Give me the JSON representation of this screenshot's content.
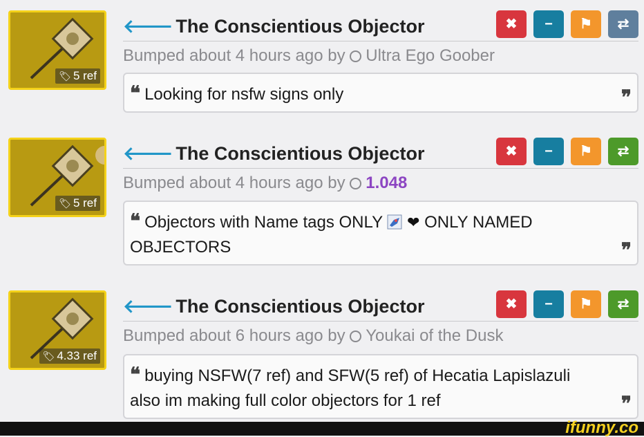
{
  "listings": [
    {
      "title": "The Conscientious Objector",
      "bump_prefix": "Bumped about 4 hours ago by",
      "user": "Ultra Ego Goober",
      "ref": "5 ref",
      "message": "Looking for nsfw signs only"
    },
    {
      "title": "The Conscientious Objector",
      "bump_prefix": "Bumped about 4 hours ago by",
      "user": "1.048",
      "ref": "5 ref",
      "message_part1": "Objectors with Name tags ONLY",
      "message_part2": "ONLY NAMED OBJECTORS"
    },
    {
      "title": "The Conscientious Objector",
      "bump_prefix": "Bumped about 6 hours ago by",
      "user": "Youkai of the Dusk",
      "ref": "4.33 ref",
      "message_line1": "buying NSFW(7 ref) and SFW(5 ref) of Hecatia Lapislazuli",
      "message_line2": "also im making full color objectors for 1 ref"
    }
  ],
  "buttons": {
    "close": "✖",
    "hide": "−",
    "flag": "⚑",
    "trade": "⇄"
  },
  "watermark": "ifunny.co",
  "colors": {
    "back_arrow": "#2196c8",
    "close": "#d8363e",
    "hide": "#177ea0",
    "flag": "#f3962c",
    "trade_gray": "#5f7f9d",
    "trade_green": "#4d9a2a",
    "purple_user": "#8c45c2",
    "thumb_bg": "#b89a12",
    "thumb_border": "#f4d21a"
  },
  "icons": [
    "back-arrow-icon",
    "tag-icon",
    "circle-icon",
    "close-icon",
    "minus-icon",
    "flag-icon",
    "swap-icon",
    "open-quote-icon",
    "close-quote-icon",
    "rocket-emoji-icon",
    "heart-icon"
  ]
}
